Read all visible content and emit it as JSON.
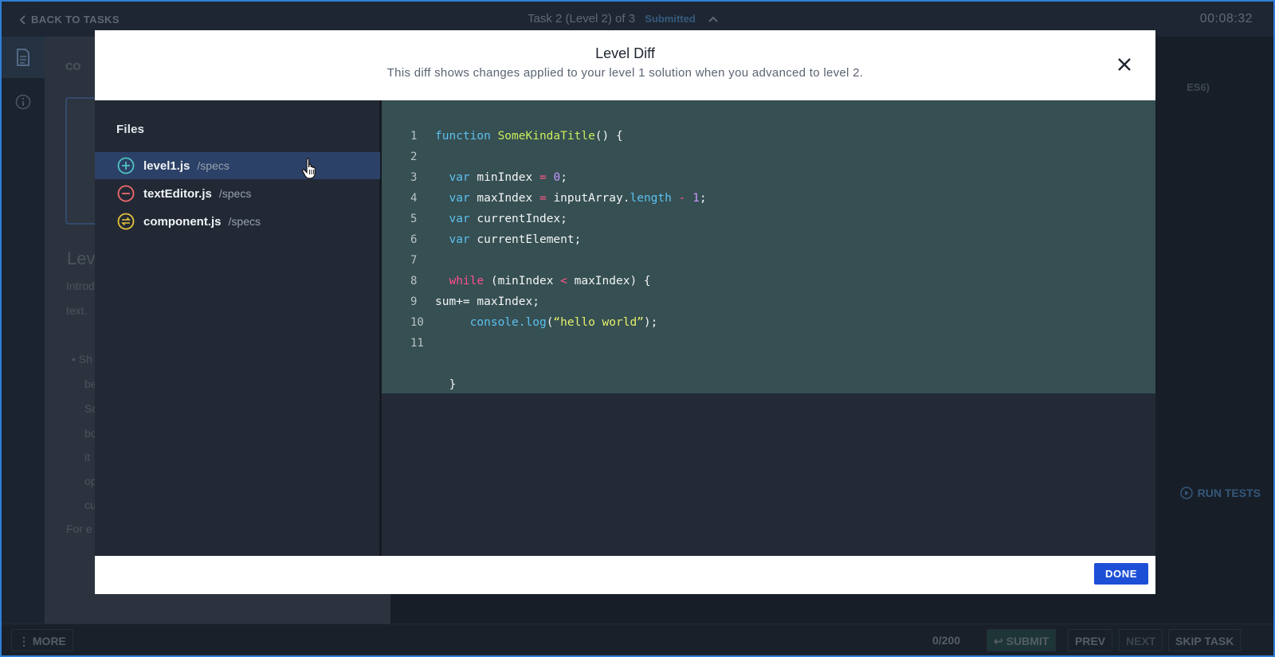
{
  "topbar": {
    "back_label": "BACK TO TASKS",
    "task_title": "Task 2 (Level 2) of 3",
    "task_status": "Submitted",
    "timer": "00:08:32"
  },
  "background": {
    "panel_tag": "CO",
    "heading": "Lev",
    "intro_1": "Introd",
    "intro_2": "text.",
    "bullets": [
      "• Sh",
      "be",
      "So",
      "bo",
      "it",
      "op",
      "cu"
    ],
    "for_text": "For e",
    "right_tag": "ES6)",
    "run_tests": "RUN TESTS"
  },
  "bottombar": {
    "more": "⋮ MORE",
    "counter": "0/200",
    "submit": "↩ SUBMIT",
    "prev": "PREV",
    "next": "NEXT",
    "skip": "SKIP TASK"
  },
  "modal": {
    "title": "Level Diff",
    "subtitle": "This diff shows changes applied to your level 1 solution when you advanced to level 2.",
    "files_title": "Files",
    "files": [
      {
        "name": "level1.js",
        "path": "/specs",
        "status": "added",
        "icon": "plus-circle-icon",
        "color": "#4fc3c0"
      },
      {
        "name": "textEditor.js",
        "path": "/specs",
        "status": "removed",
        "icon": "minus-circle-icon",
        "color": "#ef6a6a"
      },
      {
        "name": "component.js",
        "path": "/specs",
        "status": "modified",
        "icon": "swap-circle-icon",
        "color": "#e8c33b"
      }
    ],
    "code_lines": [
      {
        "n": "1",
        "text": "function SomeKindaTitle() {"
      },
      {
        "n": "2",
        "text": ""
      },
      {
        "n": "3",
        "text": "  var minIndex = 0;"
      },
      {
        "n": "4",
        "text": "  var maxIndex = inputArray.length - 1;"
      },
      {
        "n": "5",
        "text": "  var currentIndex;"
      },
      {
        "n": "6",
        "text": "  var currentElement;"
      },
      {
        "n": "7",
        "text": ""
      },
      {
        "n": "8",
        "text": "  while (minIndex < maxIndex) {"
      },
      {
        "n": "9",
        "text": "sum+= maxIndex;"
      },
      {
        "n": "10",
        "text": "     console.log(“hello world”);"
      },
      {
        "n": "11",
        "text": ""
      },
      {
        "n": "",
        "text": ""
      },
      {
        "n": "",
        "text": "  }"
      }
    ],
    "done_label": "DONE"
  },
  "colors": {
    "code_bg_added": "#364f52",
    "selected_row": "#2c4167",
    "done_button": "#1d4fd6"
  }
}
